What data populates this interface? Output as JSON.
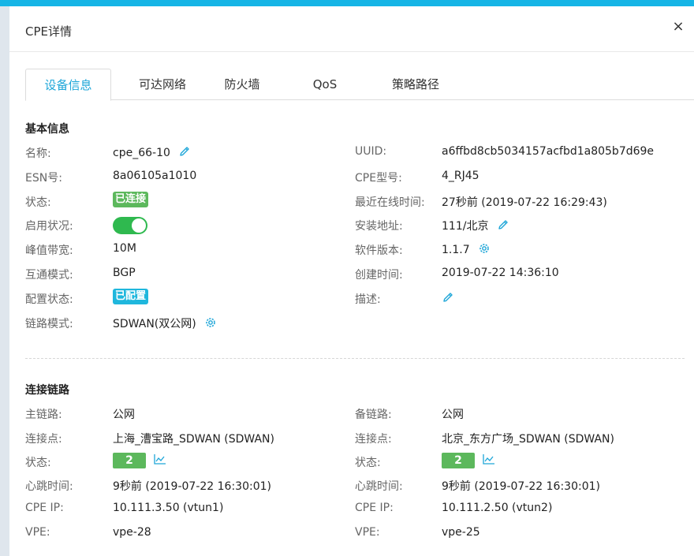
{
  "dialog": {
    "title": "CPE详情",
    "close_label": "×"
  },
  "tabs": [
    {
      "label": "设备信息",
      "active": true
    },
    {
      "label": "可达网络",
      "active": false
    },
    {
      "label": "防火墙",
      "active": false
    },
    {
      "label": "QoS",
      "active": false
    },
    {
      "label": "策略路径",
      "active": false
    }
  ],
  "basic": {
    "section_title": "基本信息",
    "name_label": "名称:",
    "name_value": "cpe_66-10",
    "esn_label": "ESN号:",
    "esn_value": "8a06105a1010",
    "status_label": "状态:",
    "status_value": "已连接",
    "enable_label": "启用状况:",
    "enable_on": true,
    "bandwidth_label": "峰值带宽:",
    "bandwidth_value": "10M",
    "interconnect_label": "互通模式:",
    "interconnect_value": "BGP",
    "config_label": "配置状态:",
    "config_value": "已配置",
    "link_mode_label": "链路模式:",
    "link_mode_value": "SDWAN(双公网)",
    "uuid_label": "UUID:",
    "uuid_value": "a6ffbd8cb5034157acfbd1a805b7d69e",
    "cpe_model_label": "CPE型号:",
    "cpe_model_value": "4_RJ45",
    "last_online_label": "最近在线时间:",
    "last_online_value": "27秒前 (2019-07-22 16:29:43)",
    "install_addr_label": "安装地址:",
    "install_addr_value": "111/北京",
    "software_label": "软件版本:",
    "software_value": "1.1.7",
    "created_label": "创建时间:",
    "created_value": "2019-07-22 14:36:10",
    "desc_label": "描述:"
  },
  "links": {
    "section_title": "连接链路",
    "primary": {
      "link_label": "主链路:",
      "link_value": "公网",
      "point_label": "连接点:",
      "point_value": "上海_漕宝路_SDWAN (SDWAN)",
      "status_label": "状态:",
      "status_count": "2",
      "heartbeat_label": "心跳时间:",
      "heartbeat_value": "9秒前  (2019-07-22 16:30:01)",
      "cpe_ip_label": "CPE IP:",
      "cpe_ip_value": "10.111.3.50 (vtun1)",
      "vpe_label": "VPE:",
      "vpe_value": "vpe-28"
    },
    "backup": {
      "link_label": "备链路:",
      "link_value": "公网",
      "point_label": "连接点:",
      "point_value": "北京_东方广场_SDWAN (SDWAN)",
      "status_label": "状态:",
      "status_count": "2",
      "heartbeat_label": "心跳时间:",
      "heartbeat_value": "9秒前  (2019-07-22 16:30:01)",
      "cpe_ip_label": "CPE IP:",
      "cpe_ip_value": "10.111.2.50 (vtun2)",
      "vpe_label": "VPE:",
      "vpe_value": "vpe-25"
    }
  },
  "icons": {
    "edit": "pencil-icon",
    "settings": "gear-icon",
    "chart": "chart-icon",
    "close": "close-icon"
  },
  "colors": {
    "accent": "#1ea6d8",
    "topbar": "#16b5e6",
    "green": "#5cb85c",
    "toggle_green": "#2fb94f",
    "cyan_badge": "#1fb7dd"
  }
}
